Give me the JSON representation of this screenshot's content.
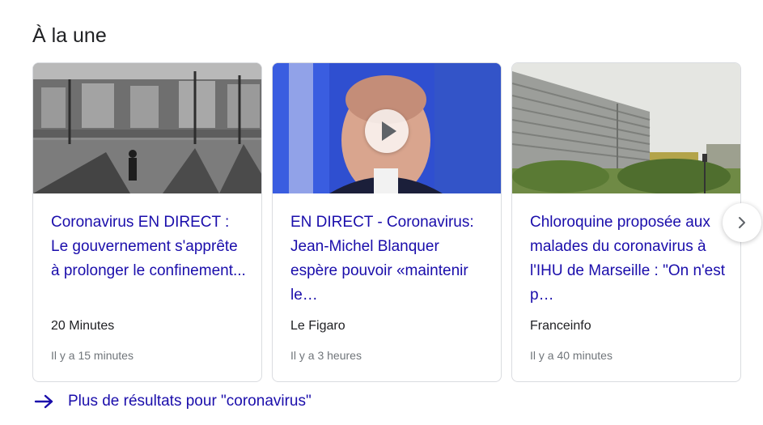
{
  "section": {
    "title": "À la une"
  },
  "cards": [
    {
      "headline": "Coronavirus EN DIRECT : Le gouvernement s'apprête à prolonger le confinement...",
      "source": "20 Minutes",
      "time": "Il y a 15 minutes",
      "image": "street-pedestrian-photo",
      "video": false
    },
    {
      "headline": "EN DIRECT - Coronavirus: Jean-Michel Blanquer espère pouvoir «maintenir le…",
      "source": "Le Figaro",
      "time": "Il y a 3 heures",
      "image": "minister-portrait-photo",
      "video": true
    },
    {
      "headline": "Chloroquine proposée aux malades du coronavirus à l'IHU de Marseille : \"On n'est p…",
      "source": "Franceinfo",
      "time": "Il y a 40 minutes",
      "image": "institute-building-photo",
      "video": false
    }
  ],
  "next_button": {
    "icon": "chevron-right-icon"
  },
  "more_link": {
    "label": "Plus de résultats pour \"coronavirus\"",
    "icon": "arrow-right-icon"
  },
  "colors": {
    "link": "#1a0dab",
    "text": "#202124",
    "muted": "#70757a",
    "border": "#dadce0"
  }
}
